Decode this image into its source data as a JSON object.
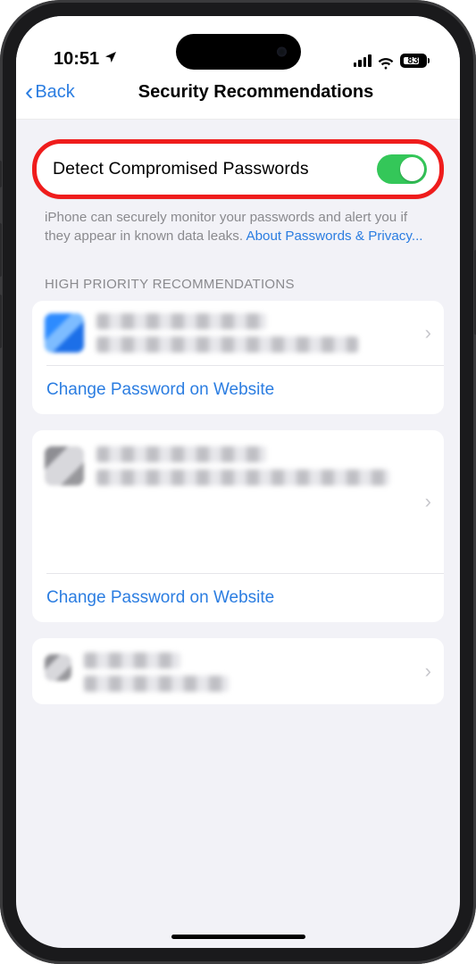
{
  "status": {
    "time": "10:51",
    "battery_pct": "83"
  },
  "nav": {
    "back_label": "Back",
    "title": "Security Recommendations"
  },
  "detect": {
    "label": "Detect Compromised Passwords",
    "footer_text": "iPhone can securely monitor your passwords and alert you if they appear in known data leaks. ",
    "footer_link": "About Passwords & Privacy..."
  },
  "section_header": "HIGH PRIORITY RECOMMENDATIONS",
  "change_pw_label": "Change Password on Website"
}
